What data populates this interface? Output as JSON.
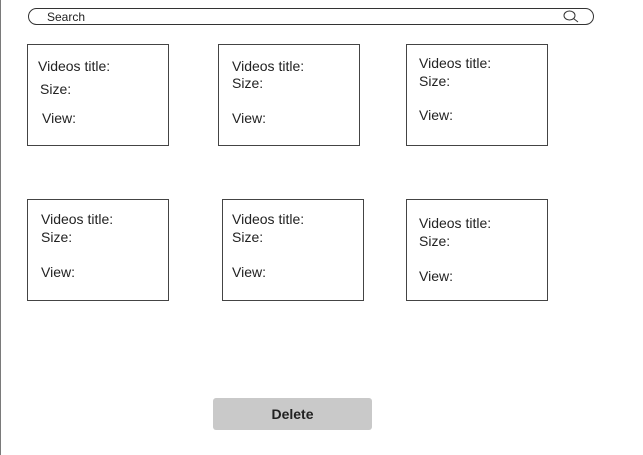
{
  "search": {
    "label": "Search",
    "icon": "search-icon"
  },
  "cards": [
    {
      "title_label": "Videos title:",
      "size_label": "Size:",
      "view_label": "View:"
    },
    {
      "title_label": "Videos title:",
      "size_label": "Size:",
      "view_label": "View:"
    },
    {
      "title_label": "Videos title:",
      "size_label": "Size:",
      "view_label": "View:"
    },
    {
      "title_label": "Videos title:",
      "size_label": "Size:",
      "view_label": "View:"
    },
    {
      "title_label": "Videos title:",
      "size_label": "Size:",
      "view_label": "View:"
    },
    {
      "title_label": "Videos title:",
      "size_label": "Size:",
      "view_label": "View:"
    }
  ],
  "actions": {
    "delete_label": "Delete"
  },
  "colors": {
    "delete_button_bg": "#c9c9c9",
    "border": "#444444"
  }
}
